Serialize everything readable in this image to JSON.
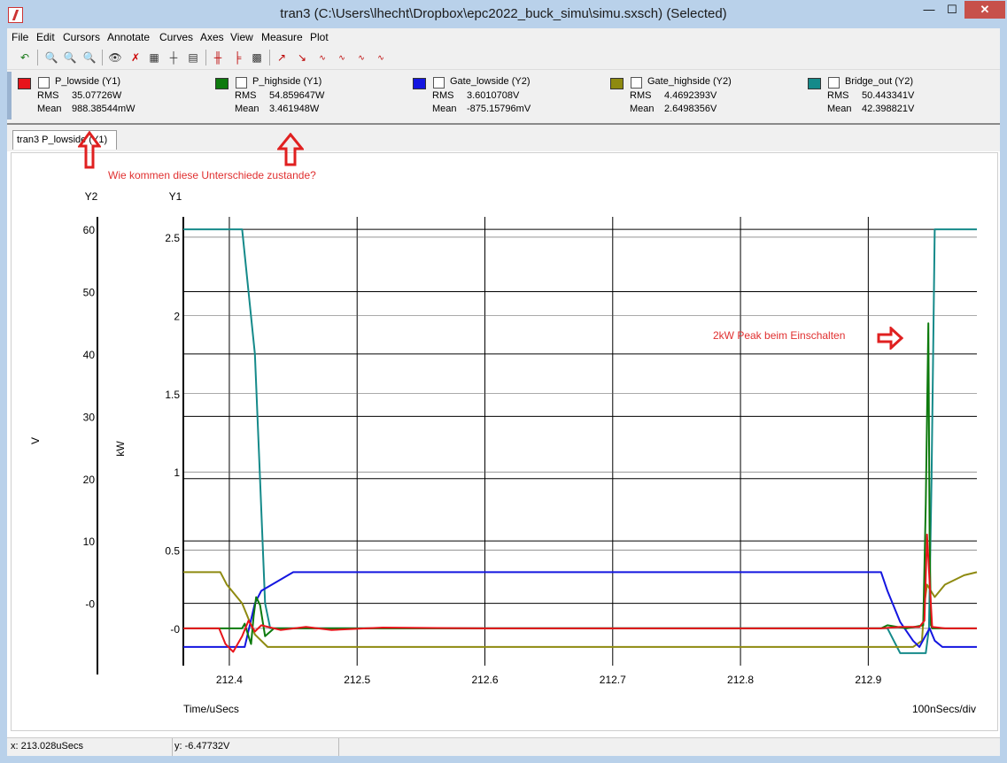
{
  "window": {
    "title": "tran3 (C:\\Users\\lhecht\\Dropbox\\epc2022_buck_simu\\simu.sxsch) (Selected)",
    "min_glyph": "—",
    "max_glyph": "☐",
    "close_glyph": "✕"
  },
  "menu": [
    "File",
    "Edit",
    "Cursors",
    "Annotate",
    "Curves",
    "Axes",
    "View",
    "Measure",
    "Plot"
  ],
  "toolbar_icons": [
    "undo-icon",
    "zoom-in-icon",
    "zoom-out-icon",
    "zoom-fit-icon",
    "eye-icon",
    "delete-curve-icon",
    "label-icon",
    "cursor-icon",
    "curve-menu-icon",
    "grid-icon",
    "axes-icon",
    "measure-icon",
    "rising-icon",
    "falling-icon",
    "rms-icon",
    "avg-icon",
    "3db-low-icon",
    "3db-high-icon"
  ],
  "legend": [
    {
      "name": "P_lowside (Y1)",
      "color": "#e8141a",
      "rms_label": "RMS",
      "rms": "35.07726W",
      "mean_label": "Mean",
      "mean": "988.38544mW"
    },
    {
      "name": "P_highside (Y1)",
      "color": "#0d7a0d",
      "rms_label": "RMS",
      "rms": "54.859647W",
      "mean_label": "Mean",
      "mean": "3.461948W"
    },
    {
      "name": "Gate_lowside (Y2)",
      "color": "#1416e0",
      "rms_label": "RMS",
      "rms": "3.6010708V",
      "mean_label": "Mean",
      "mean": "-875.15796mV"
    },
    {
      "name": "Gate_highside (Y2)",
      "color": "#8e8a10",
      "rms_label": "RMS",
      "rms": "4.4692393V",
      "mean_label": "Mean",
      "mean": "2.6498356V"
    },
    {
      "name": "Bridge_out (Y2)",
      "color": "#158a8a",
      "rms_label": "RMS",
      "rms": "50.443341V",
      "mean_label": "Mean",
      "mean": "42.398821V"
    }
  ],
  "tab": {
    "label": "tran3 P_lowside (Y1)"
  },
  "annotations": {
    "question": "Wie kommen diese Unterschiede zustande?",
    "peak": "2kW Peak beim Einschalten",
    "color": "#e03030"
  },
  "status": {
    "x": "x: 213.028uSecs",
    "y": "y: -6.47732V"
  },
  "chart_data": {
    "type": "line",
    "xlabel": "Time/uSecs",
    "x_division": "100nSecs/div",
    "xlim": [
      212.364,
      212.985
    ],
    "x_ticks": [
      "212.4",
      "212.5",
      "212.6",
      "212.7",
      "212.8",
      "212.9"
    ],
    "y1": {
      "name": "Y1",
      "label": "kW",
      "ylim": [
        -0.238,
        2.63
      ],
      "ticks": [
        "2.5",
        "2",
        "1.5",
        "1",
        "0.5",
        "-0"
      ]
    },
    "y2": {
      "name": "Y2",
      "label": "V",
      "ylim": [
        -10,
        62
      ],
      "ticks": [
        "60",
        "50",
        "40",
        "30",
        "20",
        "10",
        "-0"
      ]
    },
    "grid": true,
    "series": [
      {
        "name": "Bridge_out (Y2)",
        "axis": "y2",
        "color": "#158a8a",
        "x": [
          212.364,
          212.375,
          212.38,
          212.395,
          212.41,
          212.42,
          212.424,
          212.428,
          212.432,
          212.45,
          212.6,
          212.8,
          212.905,
          212.915,
          212.925,
          212.935,
          212.945,
          212.9475,
          212.9495,
          212.952,
          212.962,
          212.985
        ],
        "y": [
          60,
          60,
          60,
          60,
          60,
          40,
          20,
          0,
          -4,
          -4,
          -4,
          -4,
          -4,
          -4,
          -8,
          -8,
          -8,
          -4,
          20,
          60,
          60,
          60
        ]
      },
      {
        "name": "Gate_highside (Y2)",
        "axis": "y2",
        "color": "#8e8a10",
        "x": [
          212.364,
          212.38,
          212.385,
          212.393,
          212.398,
          212.41,
          212.42,
          212.43,
          212.6,
          212.935,
          212.942,
          212.944,
          212.946,
          212.952,
          212.96,
          212.975,
          212.985
        ],
        "y": [
          5,
          5,
          5,
          5,
          3,
          0,
          -5,
          -7,
          -7,
          -7,
          -6,
          0,
          3,
          1,
          3,
          4.5,
          5
        ]
      },
      {
        "name": "Gate_lowside (Y2)",
        "axis": "y2",
        "color": "#1416e0",
        "x": [
          212.364,
          212.38,
          212.395,
          212.412,
          212.42,
          212.425,
          212.45,
          212.6,
          212.905,
          212.91,
          212.915,
          212.925,
          212.935,
          212.94,
          212.948,
          212.952,
          212.958,
          212.985
        ],
        "y": [
          -7,
          -7,
          -7,
          -7,
          0,
          2,
          5,
          5,
          5,
          5,
          2,
          -3,
          -6,
          -7,
          -4,
          -6,
          -7,
          -7
        ]
      },
      {
        "name": "P_highside (Y1)",
        "axis": "y1",
        "color": "#0d7a0d",
        "x": [
          212.364,
          212.38,
          212.395,
          212.41,
          212.412,
          212.415,
          212.417,
          212.419,
          212.421,
          212.424,
          212.428,
          212.435,
          212.6,
          212.91,
          212.915,
          212.93,
          212.943,
          212.945,
          212.947,
          212.948,
          212.949,
          212.95,
          212.96,
          212.985
        ],
        "y": [
          0,
          0,
          0,
          0,
          0.03,
          -0.05,
          -0.1,
          0.08,
          0.2,
          0.15,
          -0.05,
          0,
          0,
          0,
          0.02,
          0,
          0.02,
          0.8,
          1.95,
          0.6,
          0.02,
          0,
          0,
          0
        ]
      },
      {
        "name": "P_lowside (Y1)",
        "axis": "y1",
        "color": "#e8141a",
        "x": [
          212.364,
          212.38,
          212.392,
          212.397,
          212.403,
          212.41,
          212.415,
          212.42,
          212.425,
          212.44,
          212.46,
          212.48,
          212.52,
          212.6,
          212.8,
          212.9,
          212.91,
          212.925,
          212.94,
          212.944,
          212.946,
          212.948,
          212.95,
          212.96,
          212.985
        ],
        "y": [
          0,
          0,
          0,
          -0.1,
          -0.15,
          -0.05,
          0.05,
          -0.02,
          0.02,
          -0.01,
          0.01,
          -0.01,
          0.005,
          0,
          0,
          0,
          0,
          0.01,
          0.01,
          0.05,
          0.6,
          0.3,
          0.01,
          0,
          0
        ]
      }
    ]
  }
}
